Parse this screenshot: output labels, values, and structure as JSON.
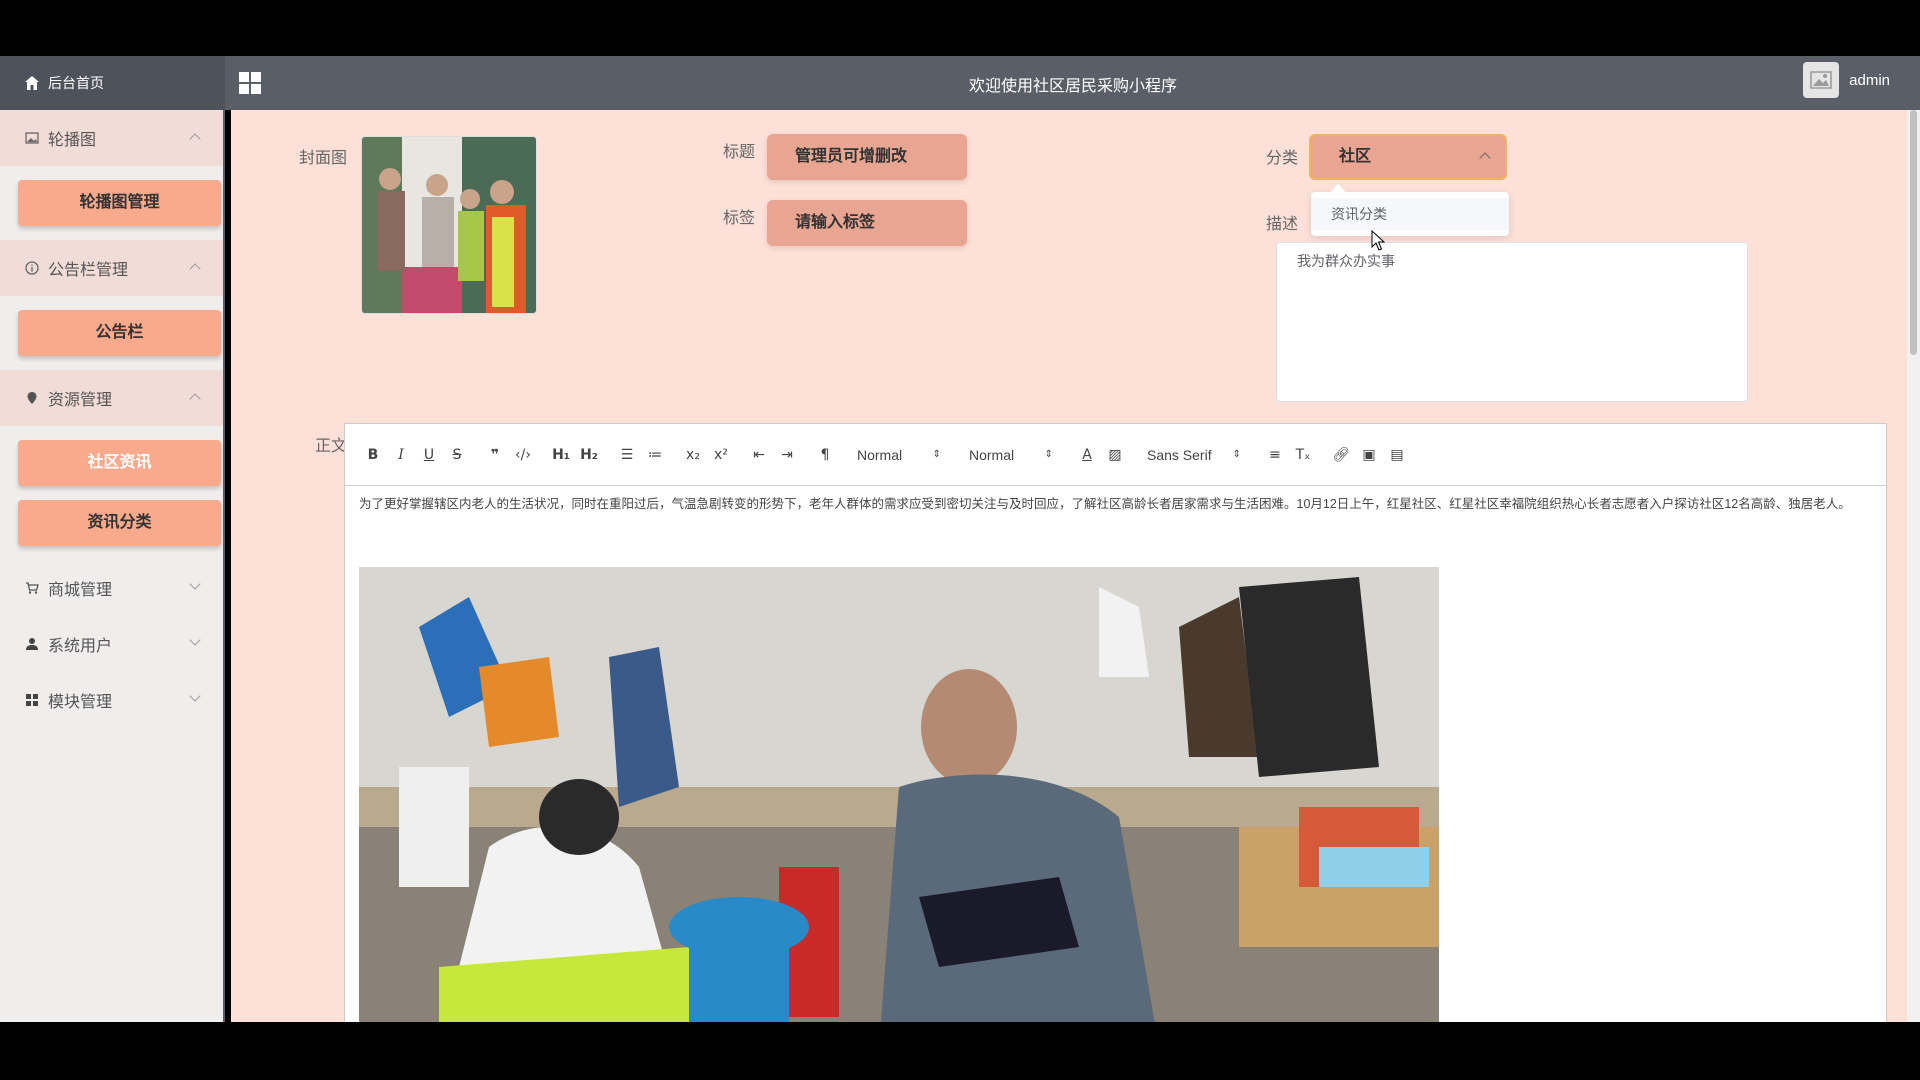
{
  "header": {
    "home_label": "后台首页",
    "title": "欢迎使用社区居民采购小程序",
    "username": "admin"
  },
  "sidebar": {
    "groups": [
      {
        "label": "轮播图",
        "icon": "image-icon",
        "expanded": true,
        "items": [
          "轮播图管理"
        ]
      },
      {
        "label": "公告栏管理",
        "icon": "info-icon",
        "expanded": true,
        "items": [
          "公告栏"
        ]
      },
      {
        "label": "资源管理",
        "icon": "location-icon",
        "expanded": true,
        "items": [
          "社区资讯",
          "资讯分类"
        ]
      },
      {
        "label": "商城管理",
        "icon": "cart-icon",
        "expanded": false,
        "items": []
      },
      {
        "label": "系统用户",
        "icon": "user-icon",
        "expanded": false,
        "items": []
      },
      {
        "label": "模块管理",
        "icon": "grid-icon",
        "expanded": false,
        "items": []
      }
    ]
  },
  "form": {
    "cover_label": "封面图",
    "title_label": "标题",
    "title_value": "管理员可增删改",
    "tag_label": "标签",
    "tag_placeholder": "请输入标签",
    "category_label": "分类",
    "category_value": "社区",
    "category_options": [
      "资讯分类"
    ],
    "desc_label": "描述",
    "desc_value": "我为群众办实事",
    "body_label": "正文"
  },
  "editor": {
    "toolbar": {
      "header_select": "Normal",
      "size_select": "Normal",
      "font_select": "Sans Serif"
    },
    "content": "为了更好掌握辖区内老人的生活状况，同时在重阳过后，气温急剧转变的形势下，老年人群体的需求应受到密切关注与及时回应，了解社区高龄长者居家需求与生活困难。10月12日上午，红星社区、红星社区幸福院组织热心长者志愿者入户探访社区12名高龄、独居老人。"
  },
  "colors": {
    "header_bg": "#5a5f67",
    "main_bg": "#fde0d8",
    "accent": "#f9a98c",
    "input_bg": "#e8a592"
  }
}
